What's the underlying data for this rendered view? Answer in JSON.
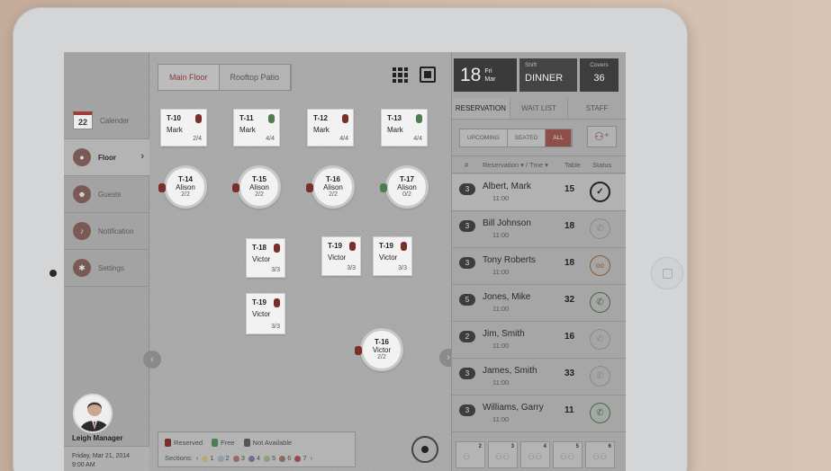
{
  "floor_tabs": [
    "Main Floor",
    "Rooftop Patio"
  ],
  "sidebar": {
    "items": [
      {
        "label": "Calender",
        "icon": "calendar-icon",
        "badge": "22"
      },
      {
        "label": "Floor",
        "icon": "floor-icon"
      },
      {
        "label": "Guests",
        "icon": "guests-icon"
      },
      {
        "label": "Notification",
        "icon": "bell-icon"
      },
      {
        "label": "Settings",
        "icon": "gear-icon"
      }
    ],
    "manager_name": "Leigh Manager",
    "manager_date": "Friday, Mar 21, 2014",
    "manager_time": "9:00 AM"
  },
  "tables": [
    {
      "id": "T-10",
      "name": "Mark",
      "covers": "2/4"
    },
    {
      "id": "T-11",
      "name": "Mark",
      "covers": "4/4"
    },
    {
      "id": "T-12",
      "name": "Mark",
      "covers": "4/4"
    },
    {
      "id": "T-13",
      "name": "Mark",
      "covers": "4/4"
    },
    {
      "id": "T-14",
      "name": "Alison",
      "covers": "2/2"
    },
    {
      "id": "T-15",
      "name": "Alison",
      "covers": "2/2"
    },
    {
      "id": "T-16",
      "name": "Alison",
      "covers": "2/2"
    },
    {
      "id": "T-17",
      "name": "Alison",
      "covers": "0/2"
    },
    {
      "id": "T-18",
      "name": "Victor",
      "covers": "3/3"
    },
    {
      "id": "T-19",
      "name": "Victor",
      "covers": "3/3"
    },
    {
      "id": "T-19",
      "name": "Victor",
      "covers": "3/3"
    },
    {
      "id": "T-19",
      "name": "Victor",
      "covers": "3/3"
    },
    {
      "id": "T-16",
      "name": "Victor",
      "covers": "2/2"
    }
  ],
  "legend": {
    "reserved": "Reserved",
    "free": "Free",
    "not_available": "Not Available",
    "sections_label": "Sections:",
    "sections": [
      "1",
      "2",
      "3",
      "4",
      "5",
      "6",
      "7"
    ],
    "section_colors": [
      "#b9a97a",
      "#8f9fae",
      "#9a6a6a",
      "#6f6f8f",
      "#8aa07a",
      "#8a6a5a",
      "#9a4a4a"
    ]
  },
  "header": {
    "day": "18",
    "weekday": "Fri",
    "month": "Mar",
    "shift_label": "Shift",
    "shift": "DINNER",
    "covers_label": "Covers",
    "covers": "36"
  },
  "panel_tabs": [
    "RESERVATION",
    "WAIT LIST",
    "STAFF"
  ],
  "filters": [
    "UPCOMING",
    "SEATED",
    "ALL"
  ],
  "columns": {
    "num": "#",
    "reservation": "Reservation ▾ / Tme ▾",
    "table": "Table",
    "status": "Status"
  },
  "reservations": [
    {
      "party": "3",
      "name": "Albert, Mark",
      "time": "11:00",
      "table": "15",
      "status": "seated"
    },
    {
      "party": "3",
      "name": "Bill Johnson",
      "time": "11:00",
      "table": "18",
      "status": "call"
    },
    {
      "party": "3",
      "name": "Tony Roberts",
      "time": "11:00",
      "table": "18",
      "status": "voicemail"
    },
    {
      "party": "5",
      "name": "Jones, Mike",
      "time": "11:00",
      "table": "32",
      "status": "calling"
    },
    {
      "party": "2",
      "name": "Jim, Smith",
      "time": "11:00",
      "table": "16",
      "status": "call"
    },
    {
      "party": "3",
      "name": "James, Smith",
      "time": "11:00",
      "table": "33",
      "status": "call"
    },
    {
      "party": "3",
      "name": "Williams, Garry",
      "time": "11:00",
      "table": "11",
      "status": "calling"
    }
  ],
  "party_sizes": [
    "2",
    "3",
    "4",
    "5",
    "6"
  ],
  "colors": {
    "accent": "#8e4f4a",
    "reserved": "#7a2e2a",
    "free": "#4f7d4f"
  }
}
